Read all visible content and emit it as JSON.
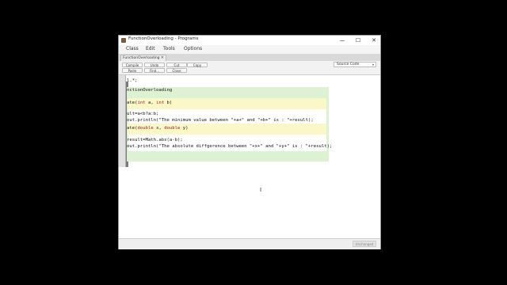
{
  "window": {
    "title": "FunctionOverloading - Programs"
  },
  "window_controls": {
    "minimize": "—",
    "maximize": "☐",
    "close": "✕"
  },
  "menu": {
    "items": [
      "Class",
      "Edit",
      "Tools",
      "Options"
    ]
  },
  "tab": {
    "label": "FunctionOverloading",
    "close": "✕"
  },
  "toolbar": {
    "row1": [
      "Compile",
      "Undo",
      "Cut",
      "Copy"
    ],
    "row2": [
      "Paste",
      "Find...",
      "Close"
    ],
    "source_select": "Source Code",
    "source_arrow": "▾"
  },
  "code": {
    "line1": "l.*;",
    "line2": "nctionOverloading",
    "line3a": "ate(",
    "line3b": "int",
    "line3c": " a, ",
    "line3d": "int",
    "line3e": " b)",
    "line4": "ult=a<b?a:b;",
    "line5": "out.println(\"The minimum value between \"+a+\" and \"+b+\" is : \"+result);",
    "line6a": "ate(",
    "line6b": "double",
    "line6c": " x, ",
    "line6d": "double",
    "line6e": " y)",
    "line7": "result=Math.abs(a-b);",
    "line8": "out.println(\"The absolute diffgerence between \"+x+\" and \"+y+\" is : \"+result);"
  },
  "status": {
    "text": "Unchanged"
  }
}
